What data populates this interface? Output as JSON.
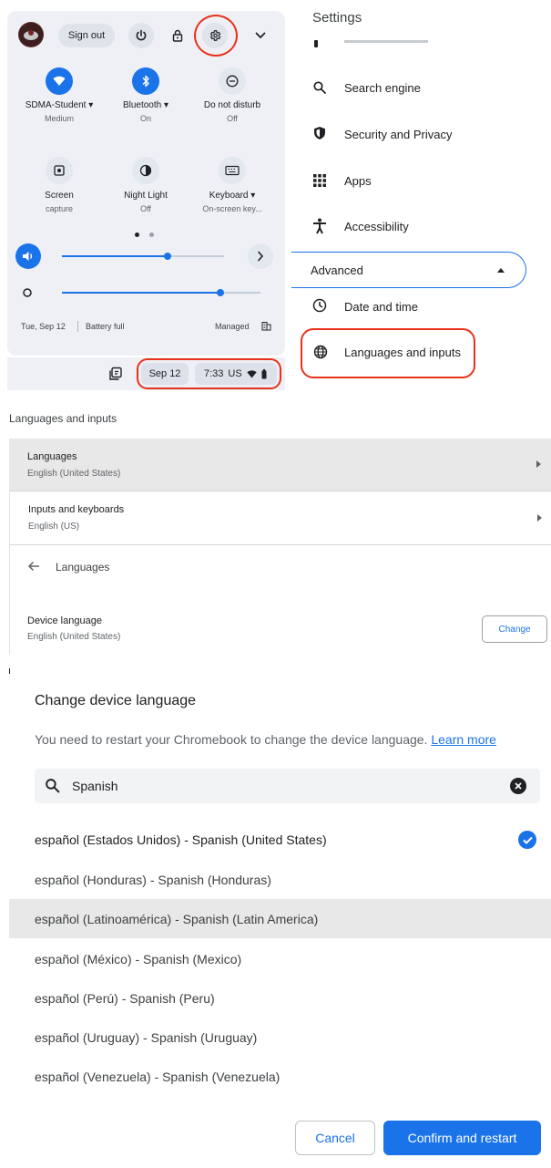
{
  "quick_settings": {
    "sign_out": "Sign out",
    "tiles": [
      {
        "title": "SDMA-Student",
        "sub": "Medium",
        "dropdown": "▾"
      },
      {
        "title": "Bluetooth",
        "sub": "On",
        "dropdown": "▾"
      },
      {
        "title": "Do not disturb",
        "sub": "Off"
      },
      {
        "title": "Screen",
        "sub": "capture"
      },
      {
        "title": "Night Light",
        "sub": "Off"
      },
      {
        "title": "Keyboard",
        "sub": "On-screen key...",
        "dropdown": "▾"
      }
    ],
    "volume_level": 0.65,
    "brightness_level": 0.8,
    "date": "Tue, Sep 12",
    "battery": "Battery full",
    "managed": "Managed"
  },
  "shelf": {
    "date": "Sep 12",
    "time": "7:33",
    "locale": "US"
  },
  "settings_menu": {
    "title": "Settings",
    "items": [
      {
        "label": "Search engine",
        "icon": "search-icon"
      },
      {
        "label": "Security and Privacy",
        "icon": "shield-icon"
      },
      {
        "label": "Apps",
        "icon": "apps-grid-icon"
      },
      {
        "label": "Accessibility",
        "icon": "accessibility-icon"
      }
    ],
    "advanced": "Advanced",
    "advanced_items": [
      {
        "label": "Date and time",
        "icon": "clock-icon"
      },
      {
        "label": "Languages and inputs",
        "icon": "globe-icon"
      }
    ]
  },
  "languages_inputs": {
    "title": "Languages and inputs",
    "rows": [
      {
        "title": "Languages",
        "sub": "English (United States)"
      },
      {
        "title": "Inputs and keyboards",
        "sub": "English (US)"
      }
    ]
  },
  "languages_page": {
    "title": "Languages",
    "device_language_title": "Device language",
    "device_language_value": "English (United States)",
    "change": "Change"
  },
  "dialog": {
    "title": "Change device language",
    "description": "You need to restart your Chromebook to change the device language.",
    "learn_more": "Learn more",
    "search_value": "Spanish",
    "languages": [
      "español (Estados Unidos) - Spanish (United States)",
      "español (Honduras) - Spanish (Honduras)",
      "español (Latinoamérica) - Spanish (Latin America)",
      "español (México) - Spanish (Mexico)",
      "español (Perú) - Spanish (Peru)",
      "español (Uruguay) - Spanish (Uruguay)",
      "español (Venezuela) - Spanish (Venezuela)"
    ],
    "cancel": "Cancel",
    "confirm": "Confirm and restart"
  },
  "colors": {
    "accent": "#1a73e8",
    "highlight_red": "#e8321c",
    "panel_bg": "#eef0f5"
  }
}
